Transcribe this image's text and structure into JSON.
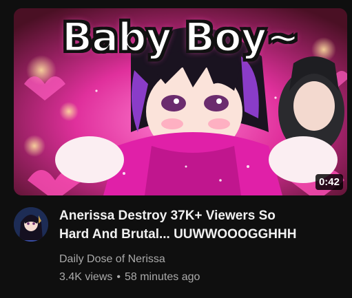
{
  "video": {
    "thumbnail_text": "Baby Boy~",
    "duration": "0:42",
    "title_line1": "Anerissa Destroy 37K+ Viewers So",
    "title_line2": "Hard And Brutal... UUWWOOOGGHHH",
    "channel": "Daily Dose of Nerissa",
    "views": "3.4K views",
    "separator": "•",
    "age": "58 minutes ago"
  },
  "colors": {
    "background": "#0f0f0f",
    "primary_text": "#f1f1f1",
    "secondary_text": "#aaaaaa",
    "accent_pink": "#e0309c"
  }
}
